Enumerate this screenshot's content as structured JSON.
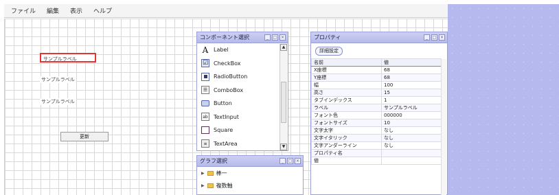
{
  "menu": [
    "ファイル",
    "編集",
    "表示",
    "ヘルプ"
  ],
  "canvas": {
    "labels": [
      "サンプルラベル",
      "サンプルラベル",
      "サンプルラベル"
    ],
    "button_label": "更新"
  },
  "component_panel": {
    "title": "コンポーネント選択",
    "items": [
      {
        "label": "Label",
        "icon": "label-icon"
      },
      {
        "label": "CheckBox",
        "icon": "checkbox-icon"
      },
      {
        "label": "RadioButton",
        "icon": "radiobutton-icon"
      },
      {
        "label": "ComboBox",
        "icon": "combobox-icon"
      },
      {
        "label": "Button",
        "icon": "button-icon"
      },
      {
        "label": "TextInput",
        "icon": "textinput-icon"
      },
      {
        "label": "Square",
        "icon": "square-icon"
      },
      {
        "label": "TextArea",
        "icon": "textarea-icon"
      }
    ]
  },
  "graph_panel": {
    "title": "グラフ選択",
    "items": [
      "棒一",
      "複数軸"
    ]
  },
  "property_panel": {
    "title": "プロパティ",
    "detail_button": "詳細設定",
    "columns": [
      "名前",
      "値"
    ],
    "rows": [
      [
        "X座標",
        "68"
      ],
      [
        "Y座標",
        "68"
      ],
      [
        "幅",
        "100"
      ],
      [
        "高さ",
        "15"
      ],
      [
        "タブインデックス",
        "1"
      ],
      [
        "ラベル",
        "サンプルラベル"
      ],
      [
        "フォント色",
        "000000"
      ],
      [
        "フォントサイズ",
        "10"
      ],
      [
        "文字太字",
        "なし"
      ],
      [
        "文字イタリック",
        "なし"
      ],
      [
        "文字アンダーライン",
        "なし"
      ],
      [
        "プロパティ名",
        ""
      ],
      [
        "値",
        ""
      ]
    ]
  },
  "colors": {
    "accent": "#b5b9ee",
    "selection": "#e33333",
    "title_bar": "#c4c8f0"
  }
}
